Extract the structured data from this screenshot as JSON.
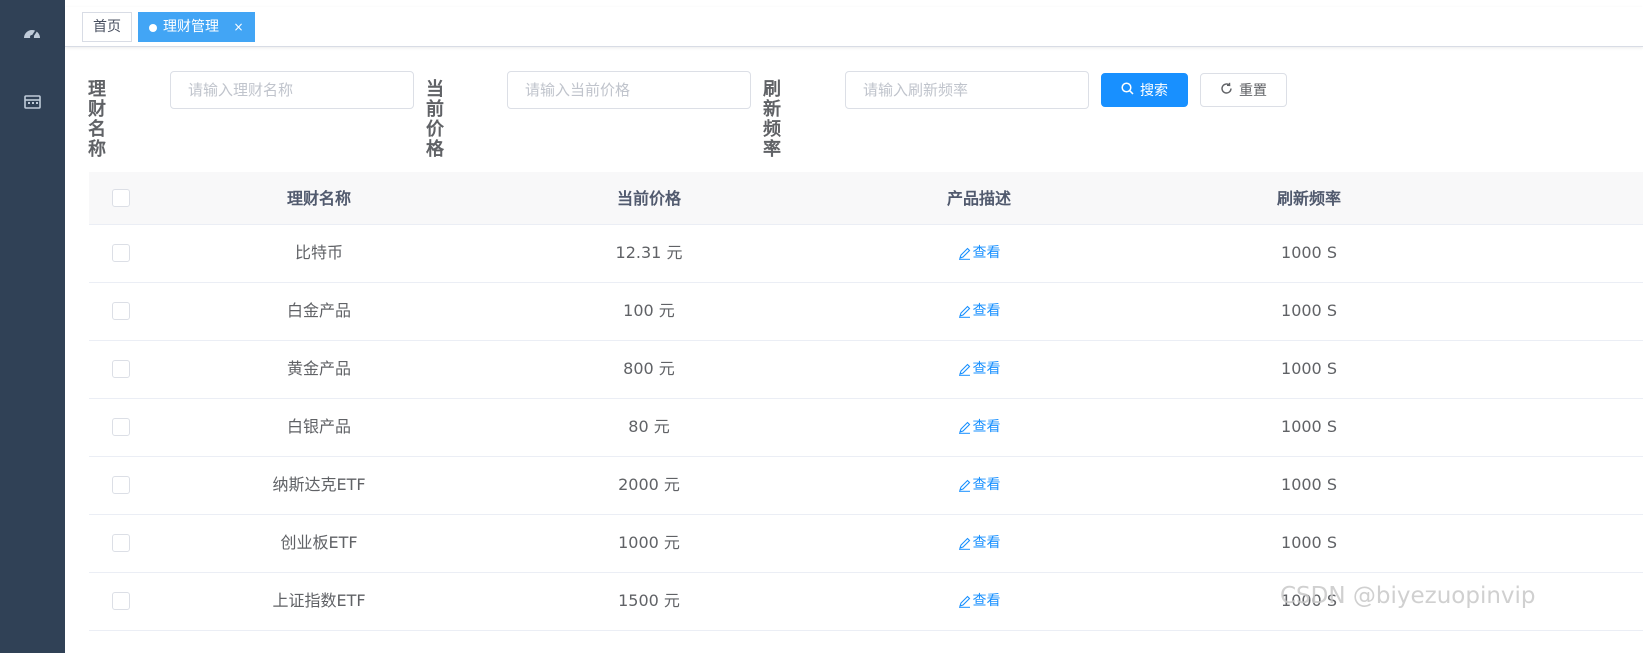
{
  "sidebar": {
    "icons": [
      "dashboard-icon",
      "calendar-icon"
    ]
  },
  "tags": [
    {
      "label": "首页",
      "active": false
    },
    {
      "label": "理财管理",
      "active": true,
      "close": "×"
    }
  ],
  "search": {
    "fields": [
      {
        "label": "理财名称",
        "placeholder": "请输入理财名称"
      },
      {
        "label": "当前价格",
        "placeholder": "请输入当前价格"
      },
      {
        "label": "刷新频率",
        "placeholder": "请输入刷新频率"
      }
    ],
    "search_label": "搜索",
    "reset_label": "重置"
  },
  "table": {
    "columns": [
      "理财名称",
      "当前价格",
      "产品描述",
      "刷新频率"
    ],
    "view_label": "查看",
    "rows": [
      {
        "name": "比特币",
        "price": "12.31 元",
        "freq": "1000 S"
      },
      {
        "name": "白金产品",
        "price": "100 元",
        "freq": "1000 S"
      },
      {
        "name": "黄金产品",
        "price": "800 元",
        "freq": "1000 S"
      },
      {
        "name": "白银产品",
        "price": "80 元",
        "freq": "1000 S"
      },
      {
        "name": "纳斯达克ETF",
        "price": "2000 元",
        "freq": "1000 S"
      },
      {
        "name": "创业板ETF",
        "price": "1000 元",
        "freq": "1000 S"
      },
      {
        "name": "上证指数ETF",
        "price": "1500 元",
        "freq": "1000 S"
      }
    ]
  },
  "watermark": "CSDN @biyezuopinvip",
  "colors": {
    "sidebar": "#304156",
    "primary": "#1890ff",
    "tag_active": "#42a5f5"
  }
}
